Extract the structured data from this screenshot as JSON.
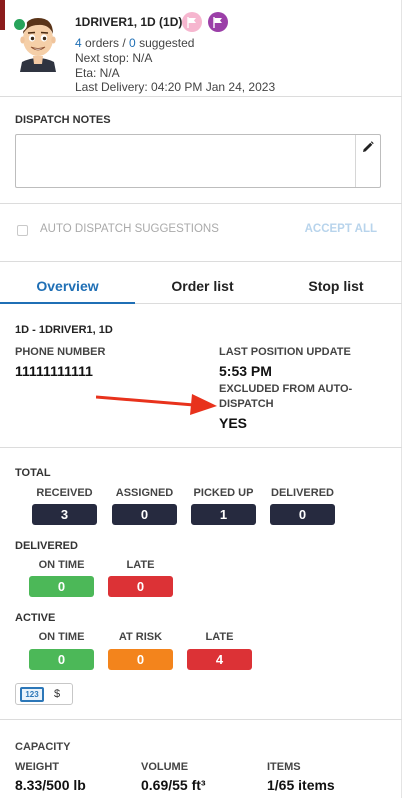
{
  "driver": {
    "name": "1DRIVER1, 1D (1D)",
    "orders_count": "4",
    "orders_text": " orders / ",
    "suggested_count": "0",
    "suggested_text": " suggested",
    "next_stop": "Next stop: N/A",
    "eta": "Eta: N/A",
    "last_delivery": "Last Delivery: 04:20 PM Jan 24, 2023",
    "status_color": "#27a35a",
    "flags": [
      "flag-pink",
      "flag-purple"
    ]
  },
  "dispatch_notes": {
    "label": "DISPATCH NOTES",
    "value": "",
    "edit_icon": "pencil-icon"
  },
  "auto_dispatch": {
    "label": "AUTO DISPATCH SUGGESTIONS",
    "checked": false,
    "accept_all": "ACCEPT ALL"
  },
  "tabs": [
    {
      "label": "Overview",
      "active": true
    },
    {
      "label": "Order list",
      "active": false
    },
    {
      "label": "Stop list",
      "active": false
    }
  ],
  "overview": {
    "title": "1D - 1DRIVER1, 1D",
    "phone_label": "PHONE NUMBER",
    "phone_value": "11111111111",
    "last_position_label": "LAST POSITION UPDATE",
    "last_position_value": "5:53 PM",
    "excluded_label_1": "EXCLUDED FROM AUTO-",
    "excluded_label_2": "DISPATCH",
    "excluded_value": "YES"
  },
  "total": {
    "label": "TOTAL",
    "columns": [
      {
        "label": "RECEIVED",
        "value": "3"
      },
      {
        "label": "ASSIGNED",
        "value": "0"
      },
      {
        "label": "PICKED UP",
        "value": "1"
      },
      {
        "label": "DELIVERED",
        "value": "0"
      }
    ]
  },
  "delivered": {
    "label": "DELIVERED",
    "columns": [
      {
        "label": "ON TIME",
        "value": "0"
      },
      {
        "label": "LATE",
        "value": "0"
      }
    ]
  },
  "active": {
    "label": "ACTIVE",
    "columns": [
      {
        "label": "ON TIME",
        "value": "0"
      },
      {
        "label": "AT RISK",
        "value": "0"
      },
      {
        "label": "LATE",
        "value": "4"
      }
    ]
  },
  "units_toggle": {
    "numeric_label": "123",
    "currency_label": "$"
  },
  "capacity": {
    "label": "CAPACITY",
    "weight_label": "WEIGHT",
    "weight_value": "8.33/500 lb",
    "volume_label": "VOLUME",
    "volume_value": "0.69/55 ft³",
    "items_label": "ITEMS",
    "items_value": "1/65 items"
  },
  "colors": {
    "accent_blue": "#1f6fb5",
    "navy_pill": "#262a3f",
    "green_pill": "#4cb858",
    "red_pill": "#dc3236",
    "orange_pill": "#f3841c",
    "annotation_arrow": "#e8321c"
  }
}
